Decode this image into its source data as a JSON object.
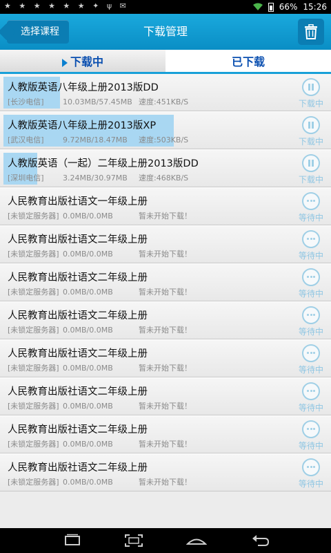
{
  "status_bar": {
    "battery": "66%",
    "time": "15:26"
  },
  "header": {
    "back_label": "选择课程",
    "title": "下载管理"
  },
  "tabs": [
    {
      "label": "下载中",
      "active": true
    },
    {
      "label": "已下载",
      "active": false
    }
  ],
  "downloads": [
    {
      "title": "人教版英语八年级上册2013版DD",
      "server": "[长沙电信]",
      "size": "10.03MB/57.45MB",
      "speed": "速度:451KB/S",
      "status": "下载中",
      "progress": 0.175
    },
    {
      "title": "人教版英语八年级上册2013版XP",
      "server": "[武汉电信]",
      "size": "9.72MB/18.47MB",
      "speed": "速度:503KB/S",
      "status": "下载中",
      "progress": 0.526
    },
    {
      "title": "人教版英语（一起）二年级上册2013版DD",
      "server": "[深圳电信]",
      "size": "3.24MB/30.97MB",
      "speed": "速度:468KB/S",
      "status": "下载中",
      "progress": 0.105
    },
    {
      "title": "人民教育出版社语文一年级上册",
      "server": "[未锁定服务器]",
      "size": "0.0MB/0.0MB",
      "speed": "暂未开始下载！",
      "status": "等待中",
      "progress": 0
    },
    {
      "title": "人民教育出版社语文二年级上册",
      "server": "[未锁定服务器]",
      "size": "0.0MB/0.0MB",
      "speed": "暂未开始下载！",
      "status": "等待中",
      "progress": 0
    },
    {
      "title": "人民教育出版社语文二年级上册",
      "server": "[未锁定服务器]",
      "size": "0.0MB/0.0MB",
      "speed": "暂未开始下载！",
      "status": "等待中",
      "progress": 0
    },
    {
      "title": "人民教育出版社语文二年级上册",
      "server": "[未锁定服务器]",
      "size": "0.0MB/0.0MB",
      "speed": "暂未开始下载！",
      "status": "等待中",
      "progress": 0
    },
    {
      "title": "人民教育出版社语文二年级上册",
      "server": "[未锁定服务器]",
      "size": "0.0MB/0.0MB",
      "speed": "暂未开始下载！",
      "status": "等待中",
      "progress": 0
    },
    {
      "title": "人民教育出版社语文二年级上册",
      "server": "[未锁定服务器]",
      "size": "0.0MB/0.0MB",
      "speed": "暂未开始下载！",
      "status": "等待中",
      "progress": 0
    },
    {
      "title": "人民教育出版社语文二年级上册",
      "server": "[未锁定服务器]",
      "size": "0.0MB/0.0MB",
      "speed": "暂未开始下载！",
      "status": "等待中",
      "progress": 0
    },
    {
      "title": "人民教育出版社语文二年级上册",
      "server": "[未锁定服务器]",
      "size": "0.0MB/0.0MB",
      "speed": "暂未开始下载！",
      "status": "等待中",
      "progress": 0
    }
  ],
  "icons": {
    "notifications": "notification-icons",
    "back_nav": "back-icon",
    "home_nav": "home-icon",
    "recent_nav": "recent-apps-icon",
    "screenshot_nav": "screenshot-icon",
    "trash": "trash-icon"
  },
  "colors": {
    "header": "#0a8ec5",
    "accent": "#18a0d8",
    "progress": "#a9d7f2"
  }
}
